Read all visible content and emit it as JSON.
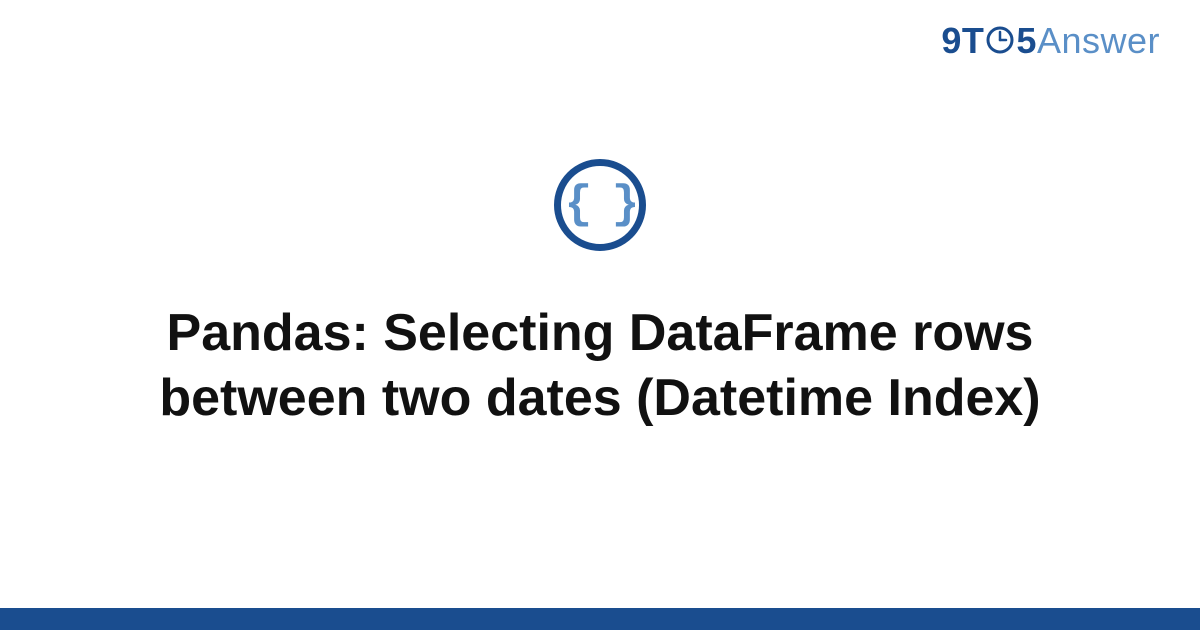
{
  "logo": {
    "part1": "9T",
    "part2": "5",
    "part3": "Answer"
  },
  "icon": {
    "braces": "{ }"
  },
  "title": "Pandas: Selecting DataFrame rows between two dates (Datetime Index)",
  "colors": {
    "primary": "#1a4d8f",
    "secondary": "#5a8fc7"
  }
}
